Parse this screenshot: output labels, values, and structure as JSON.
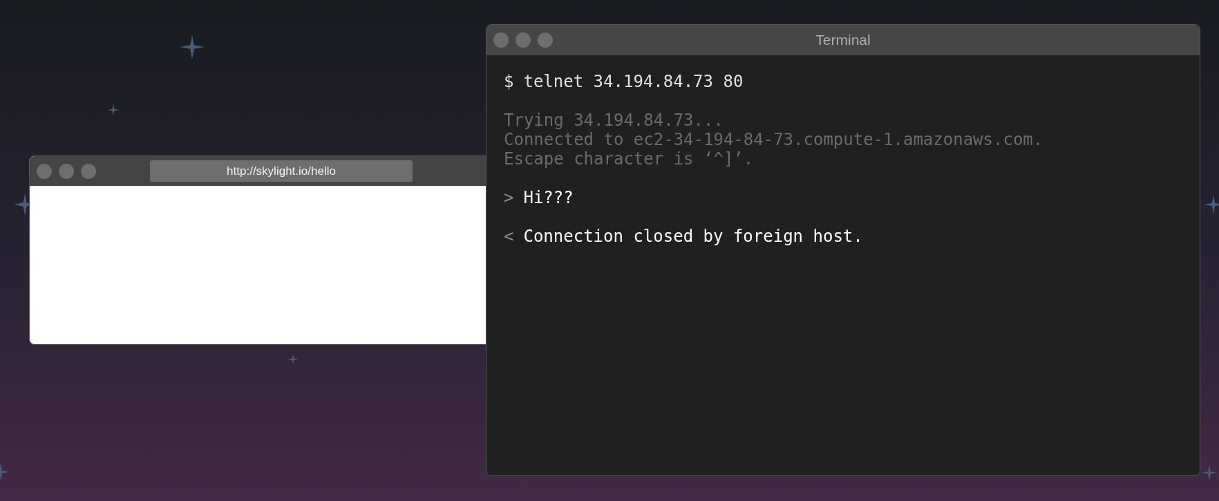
{
  "browser": {
    "address": "http://skylight.io/hello"
  },
  "terminal": {
    "title": "Terminal",
    "lines": [
      {
        "kind": "command",
        "prompt": "$",
        "text": "telnet 34.194.84.73 80"
      },
      {
        "kind": "gap"
      },
      {
        "kind": "output",
        "text": "Trying 34.194.84.73..."
      },
      {
        "kind": "output",
        "text": "Connected to ec2-34-194-84-73.compute-1.amazonaws.com."
      },
      {
        "kind": "output",
        "text": "Escape character is ‘^]’."
      },
      {
        "kind": "gap"
      },
      {
        "kind": "io",
        "prompt": ">",
        "text": "Hi???"
      },
      {
        "kind": "gap"
      },
      {
        "kind": "io",
        "prompt": "<",
        "text": "Connection closed by foreign host."
      }
    ]
  }
}
